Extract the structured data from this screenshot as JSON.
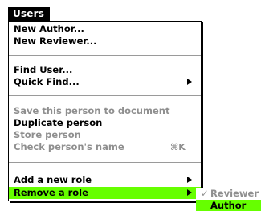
{
  "menubar": {
    "title": "Users"
  },
  "menu": {
    "items": [
      {
        "label": "New Author..."
      },
      {
        "label": "New Reviewer..."
      },
      {
        "label": "Find User..."
      },
      {
        "label": "Quick Find..."
      },
      {
        "label": "Save this person to document"
      },
      {
        "label": "Duplicate person"
      },
      {
        "label": "Store person"
      },
      {
        "label": "Check person's name",
        "shortcut": "⌘K"
      },
      {
        "label": "Add a new role"
      },
      {
        "label": "Remove a role"
      }
    ]
  },
  "submenu": {
    "items": [
      {
        "label": "Reviewer",
        "check": "✓"
      },
      {
        "label": "Author"
      }
    ]
  },
  "colors": {
    "highlight": "#66ff00",
    "disabled_text": "#8f8f8f",
    "menubar_bg": "#000000"
  }
}
